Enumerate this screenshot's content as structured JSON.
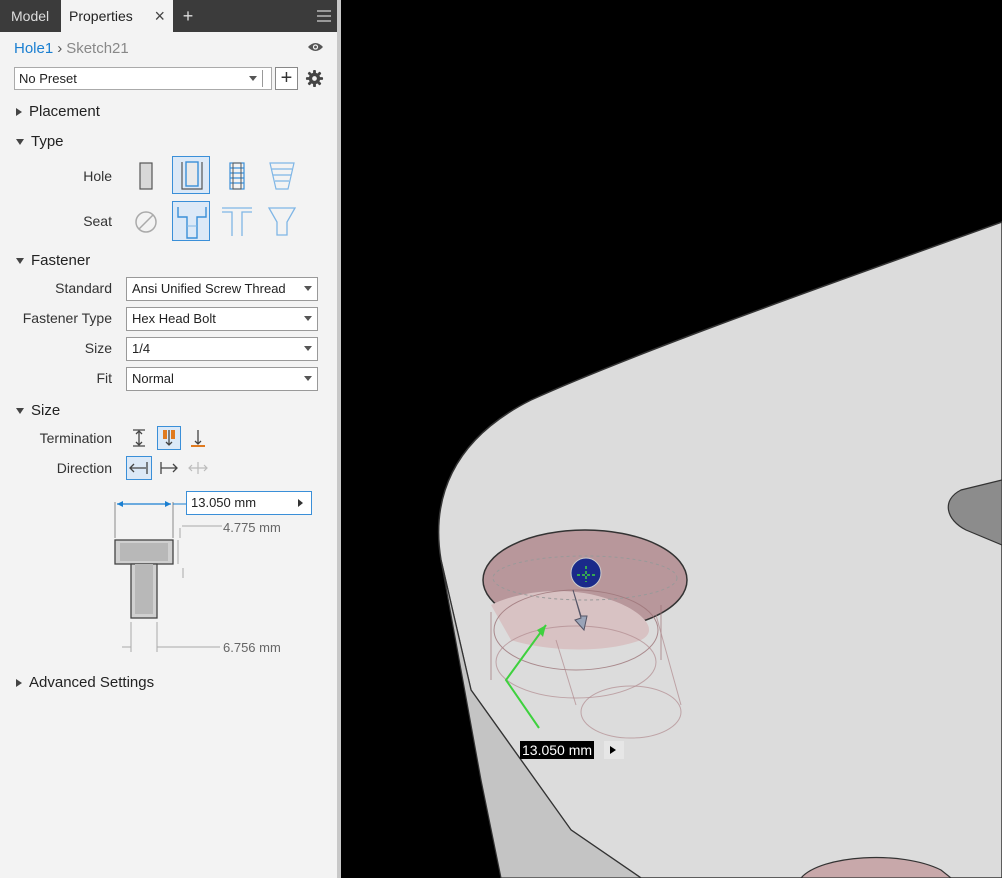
{
  "tabs": {
    "model": "Model",
    "properties": "Properties",
    "close_glyph": "×",
    "add_glyph": "+"
  },
  "breadcrumb": {
    "feature": "Hole1",
    "separator": "›",
    "sketch": "Sketch21"
  },
  "preset": {
    "value": "No Preset",
    "add_glyph": "+"
  },
  "sections": {
    "placement": "Placement",
    "type": "Type",
    "fastener": "Fastener",
    "size": "Size",
    "advanced": "Advanced Settings"
  },
  "type": {
    "hole_label": "Hole",
    "seat_label": "Seat"
  },
  "fastener": {
    "standard_label": "Standard",
    "standard_value": "Ansi Unified Screw Thread",
    "type_label": "Fastener Type",
    "type_value": "Hex Head Bolt",
    "size_label": "Size",
    "size_value": "1/4",
    "fit_label": "Fit",
    "fit_value": "Normal"
  },
  "size": {
    "termination_label": "Termination",
    "direction_label": "Direction",
    "diameter_value": "13.050 mm",
    "depth_value": "4.775 mm",
    "bottom_value": "6.756 mm"
  },
  "viewport": {
    "dimension_label": "13.050 mm"
  },
  "colors": {
    "accent": "#3a8fd8",
    "link": "#1a7fd1",
    "model_face": "#dddddd",
    "hole_tint": "#b8979b"
  }
}
